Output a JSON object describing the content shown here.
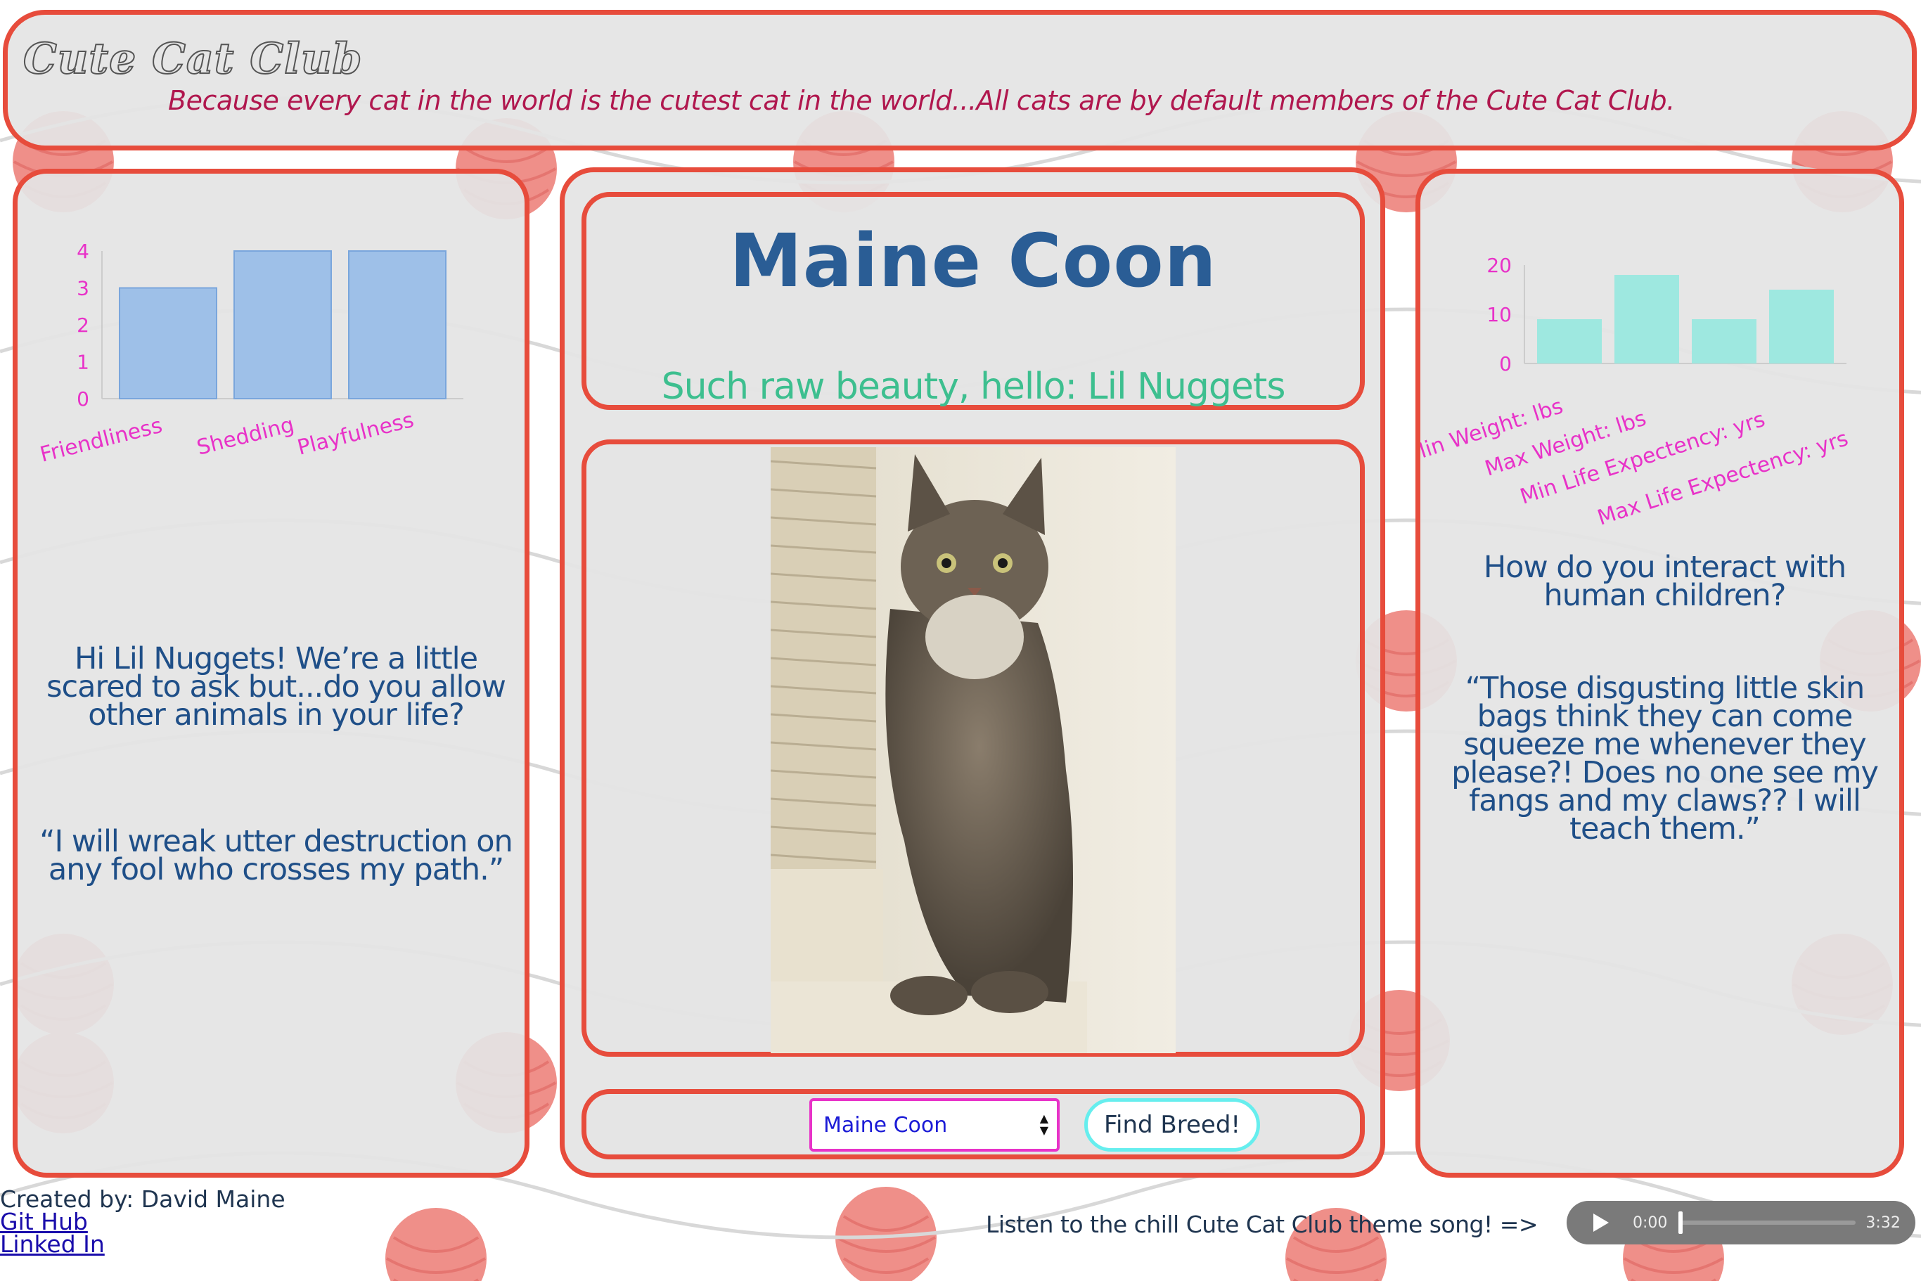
{
  "header": {
    "logo": "Cute Cat Club",
    "tagline": "Because every cat in the world is the cutest cat in the world...All cats are by default members of the Cute Cat Club."
  },
  "breed": {
    "name": "Maine Coon",
    "greeting": "Such raw beauty, hello: Lil Nuggets",
    "photo_alt": "Maine Coon kitten"
  },
  "controls": {
    "selected_breed": "Maine Coon",
    "find_button": "Find Breed!"
  },
  "left_interview": {
    "question": "Hi Lil Nuggets! We’re a little scared to ask but...do you allow other animals in your life?",
    "answer": "“I will wreak utter destruction on any fool who crosses my path.”"
  },
  "right_interview": {
    "question": "How do you interact with human children?",
    "answer": "“Those disgusting little skin bags think they can come squeeze me whenever they please?! Does no one see my fangs and my claws?? I will teach them.”"
  },
  "footer": {
    "credit": "Created by: David Maine",
    "github": "Git Hub",
    "linkedin": "Linked In",
    "theme_song_text": "Listen to the chill Cute Cat Club theme song! =>",
    "audio_current": "0:00",
    "audio_duration": "3:32"
  },
  "colors": {
    "border": "#e74c3c",
    "left_bar": "#9ec0e8",
    "right_bar": "#9ee8e0",
    "tick_label": "#e832c8"
  },
  "chart_data": [
    {
      "type": "bar",
      "categories": [
        "Friendliness",
        "Shedding",
        "Playfulness"
      ],
      "values": [
        3,
        4,
        4
      ],
      "ylim": [
        0,
        4
      ],
      "yticks": [
        "0",
        "1",
        "2",
        "3",
        "4"
      ]
    },
    {
      "type": "bar",
      "categories": [
        "Min Weight: lbs",
        "Max Weight: lbs",
        "Min Life Expectency: yrs",
        "Max Life Expectency: yrs"
      ],
      "values": [
        9,
        18,
        9,
        15
      ],
      "ylim": [
        0,
        20
      ],
      "yticks": [
        "0",
        "10",
        "20"
      ]
    }
  ]
}
